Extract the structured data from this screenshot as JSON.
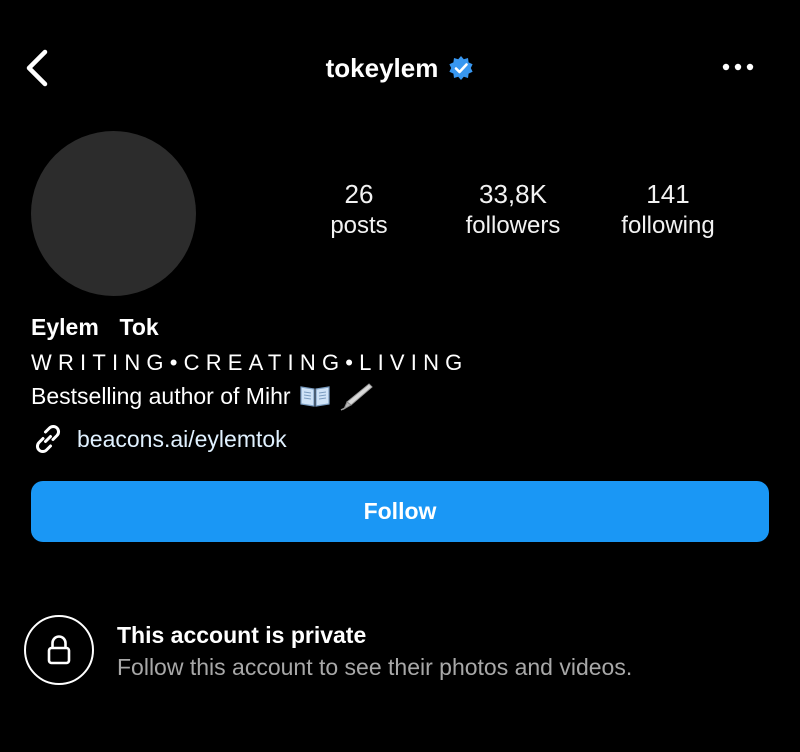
{
  "header": {
    "username": "tokeylem",
    "verified": true,
    "icons": {
      "back": "chevron-left-icon",
      "verified": "verified-badge-icon",
      "more": "more-horizontal-icon"
    }
  },
  "profile": {
    "stats": [
      {
        "value": "26",
        "label": "posts"
      },
      {
        "value": "33,8K",
        "label": "followers"
      },
      {
        "value": "141",
        "label": "following"
      }
    ],
    "display_name": "Eylem  Tok",
    "tagline": "WRITING•CREATING•LIVING",
    "bio": "Bestselling author of Mihr",
    "bio_emojis": [
      "open-book-icon",
      "fountain-pen-icon"
    ],
    "link": "beacons.ai/eylemtok"
  },
  "actions": {
    "follow_label": "Follow"
  },
  "private_notice": {
    "title": "This account is private",
    "subtitle": "Follow this account to see their photos and videos."
  },
  "colors": {
    "background": "#000000",
    "follow_button": "#1a97f5",
    "verified_badge": "#3897f0",
    "secondary_text": "#a8a8a8",
    "avatar_placeholder": "#2c2c2c"
  }
}
